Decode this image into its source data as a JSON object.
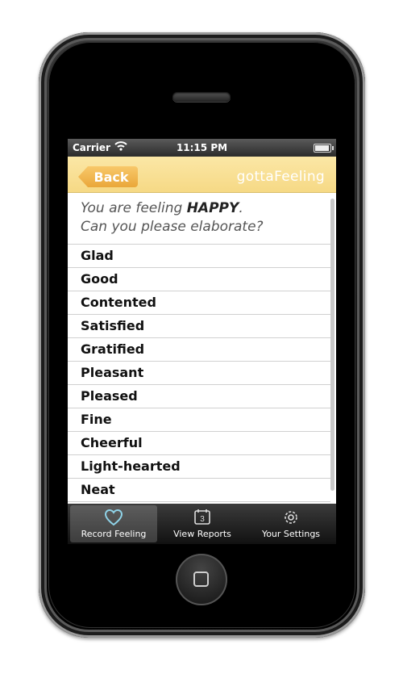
{
  "status_bar": {
    "carrier": "Carrier",
    "time": "11:15 PM"
  },
  "nav": {
    "back_label": "Back",
    "title": "gottaFeeling"
  },
  "prompt": {
    "line1_prefix": "You are feeling ",
    "emotion": "HAPPY",
    "line1_suffix": ".",
    "line2": "Can you please elaborate?"
  },
  "feelings": [
    "Glad",
    "Good",
    "Contented",
    "Satisfied",
    "Gratified",
    "Pleasant",
    "Pleased",
    "Fine",
    "Cheerful",
    "Light-hearted",
    "Neat"
  ],
  "tabs": [
    {
      "label": "Record Feeling",
      "icon": "heart-icon",
      "active": true
    },
    {
      "label": "View Reports",
      "icon": "calendar-icon",
      "active": false
    },
    {
      "label": "Your Settings",
      "icon": "gear-icon",
      "active": false
    }
  ],
  "colors": {
    "nav_bg": "#f6d985",
    "back_button": "#eaa73a",
    "accent_icon": "#8fd3e8"
  }
}
